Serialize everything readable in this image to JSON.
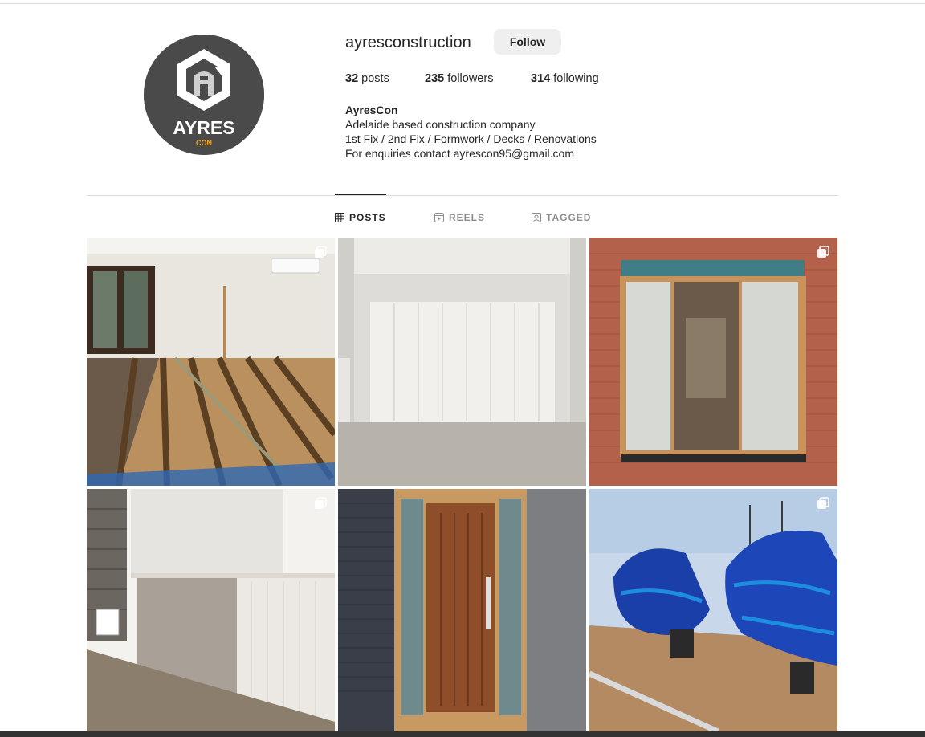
{
  "profile": {
    "username": "ayresconstruction",
    "follow_label": "Follow",
    "stats": {
      "posts_count": "32",
      "posts_label": " posts",
      "followers_count": "235",
      "followers_label": " followers",
      "following_count": "314",
      "following_label": " following"
    },
    "bio": {
      "name": "AyresCon",
      "lines": [
        "Adelaide based construction company",
        "1st Fix / 2nd Fix / Formwork / Decks / Renovations",
        "For enquiries contact ayrescon95@gmail.com"
      ]
    },
    "avatar": {
      "logo_text": "AYRES",
      "logo_subtext": "CON",
      "bg_color": "#4a4a4a",
      "accent_color": "#f2a516"
    }
  },
  "tabs": [
    {
      "label": "POSTS",
      "icon": "grid-icon",
      "active": true
    },
    {
      "label": "REELS",
      "icon": "reels-icon",
      "active": false
    },
    {
      "label": "TAGGED",
      "icon": "tagged-icon",
      "active": false
    }
  ],
  "posts": [
    {
      "subject": "floor-joists-renovation",
      "multi": true
    },
    {
      "subject": "garage-wall-lining",
      "multi": false
    },
    {
      "subject": "brick-window-frame",
      "multi": true
    },
    {
      "subject": "wall-panelling",
      "multi": true
    },
    {
      "subject": "timber-front-door",
      "multi": false
    },
    {
      "subject": "covered-furniture",
      "multi": true
    }
  ]
}
